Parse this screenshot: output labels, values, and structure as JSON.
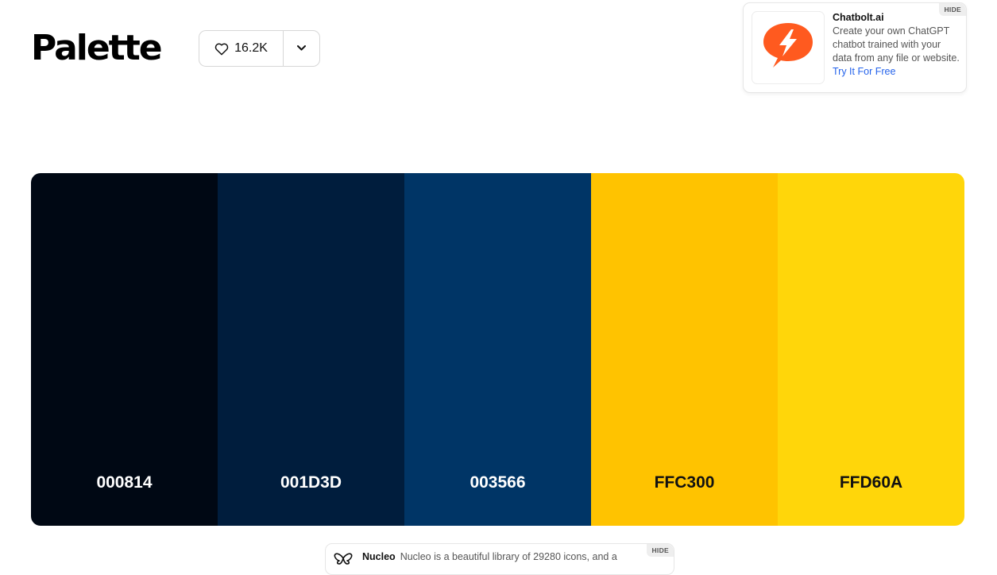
{
  "header": {
    "title": "Palette",
    "likes_count": "16.2K",
    "like_icon": "heart-icon",
    "more_icon": "chevron-down-icon"
  },
  "ad_top": {
    "hide_label": "HIDE",
    "logo_icon": "lightning-bolt-icon",
    "brand_color": "#ff5a1f",
    "title": "Chatbolt.ai",
    "description": "Create your own ChatGPT chatbot trained with your data from any file or website.",
    "cta": "Try It For Free"
  },
  "palette": {
    "colors": [
      {
        "hex": "#000814",
        "code": "000814",
        "text_color": "#ffffff"
      },
      {
        "hex": "#001D3D",
        "code": "001D3D",
        "text_color": "#ffffff"
      },
      {
        "hex": "#003566",
        "code": "003566",
        "text_color": "#ffffff"
      },
      {
        "hex": "#FFC300",
        "code": "FFC300",
        "text_color": "#111111"
      },
      {
        "hex": "#FFD60A",
        "code": "FFD60A",
        "text_color": "#111111"
      }
    ]
  },
  "ad_bottom": {
    "hide_label": "HIDE",
    "logo_icon": "butterfly-icon",
    "title": "Nucleo",
    "description": "Nucleo is a beautiful library of 29280 icons, and a"
  }
}
